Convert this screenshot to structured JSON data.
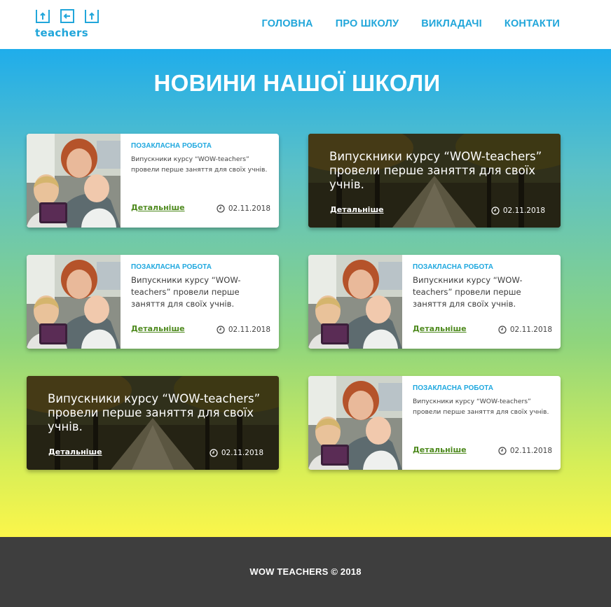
{
  "header": {
    "logo_text": "teachers",
    "nav": [
      {
        "label": "ГОЛОВНА"
      },
      {
        "label": "ПРО ШКОЛУ"
      },
      {
        "label": "ВИКЛАДАЧІ"
      },
      {
        "label": "КОНТАКТИ"
      }
    ]
  },
  "main": {
    "title": "НОВИНИ НАШОЇ ШКОЛИ",
    "cards": [
      {
        "type": "photo",
        "category": "ПОЗАКЛАСНА РОБОТА",
        "text": "Випускники курсу “WOW-teachers” провели перше заняття для своїх учнів.",
        "link": "Детальніше",
        "date": "02.11.2018"
      },
      {
        "type": "banner",
        "text": "Випускники курсу “WOW-teachers” провели перше заняття для своїх учнів.",
        "link": "Детальніше",
        "date": "02.11.2018"
      },
      {
        "type": "photo",
        "category": "ПОЗАКЛАСНА РОБОТА",
        "text": "Випускники курсу “WOW-teachers” провели перше заняття для своїх учнів.",
        "link": "Детальніше",
        "date": "02.11.2018"
      },
      {
        "type": "photo",
        "category": "ПОЗАКЛАСНА РОБОТА",
        "text": "Випускники курсу “WOW-teachers” провели перше заняття для своїх учнів.",
        "link": "Детальніше",
        "date": "02.11.2018"
      },
      {
        "type": "banner",
        "text": "Випускники курсу “WOW-teachers” провели перше заняття для своїх учнів.",
        "link": "Детальніше",
        "date": "02.11.2018"
      },
      {
        "type": "photo",
        "category": "ПОЗАКЛАСНА РОБОТА",
        "text": "Випускники курсу “WOW-teachers” провели перше заняття для своїх учнів.",
        "link": "Детальніше",
        "date": "02.11.2018"
      }
    ]
  },
  "footer": {
    "text": "WOW TEACHERS © 2018"
  },
  "colors": {
    "accent": "#21a6da",
    "link_green": "#4e8a1e",
    "gradient_top": "#1fadeb",
    "gradient_bottom": "#fbf64a",
    "footer_bg": "#3e3e3e"
  }
}
